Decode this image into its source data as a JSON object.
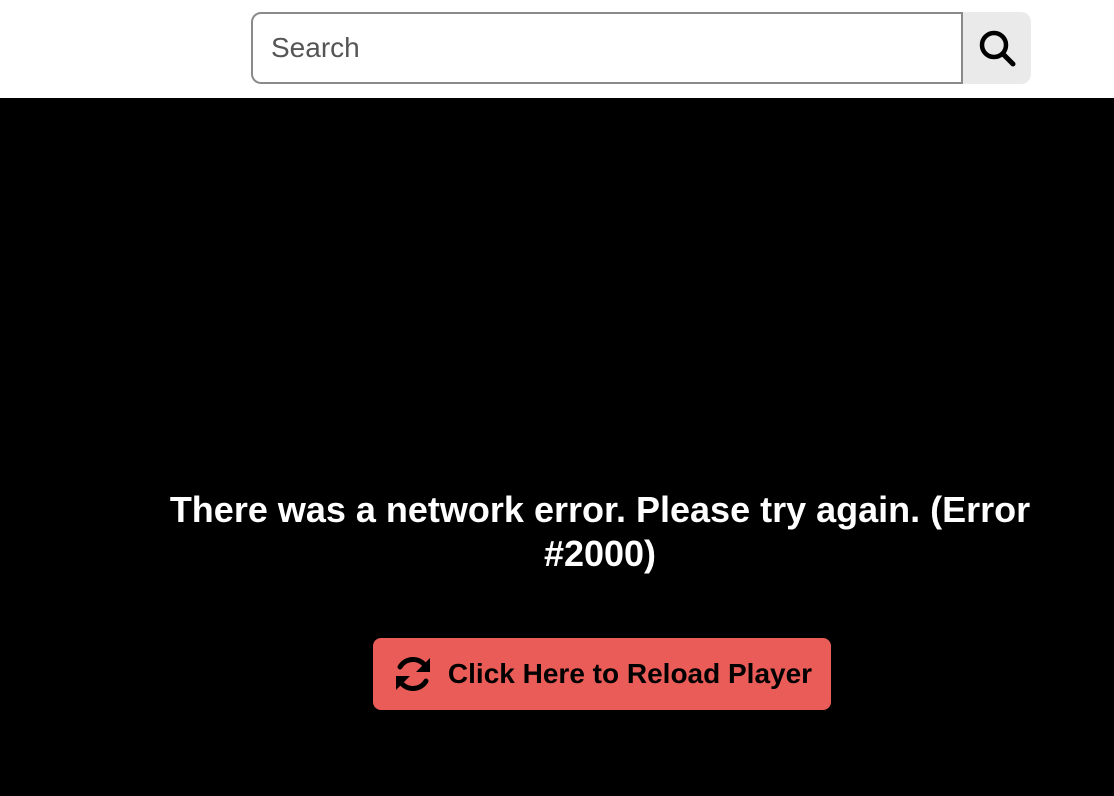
{
  "search": {
    "placeholder": "Search",
    "value": "",
    "button_icon": "search-icon"
  },
  "player": {
    "error_message": "There was a network error. Please try again. (Error #2000)",
    "reload_button_label": "Click Here to Reload Player",
    "reload_icon": "refresh-icon",
    "reload_button_color": "#ea5c57",
    "background_color": "#000000"
  }
}
